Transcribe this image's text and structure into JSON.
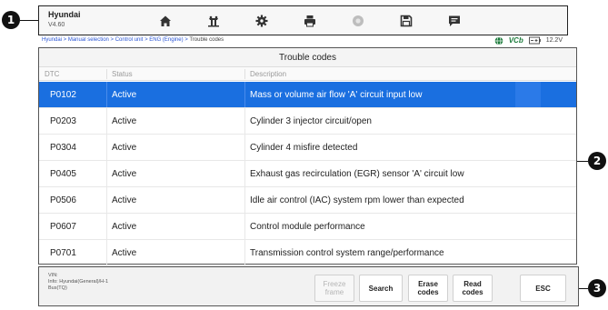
{
  "callouts": [
    "1",
    "2",
    "3"
  ],
  "app": {
    "title": "Hyundai",
    "version": "V4.60"
  },
  "toolbar": {
    "buttons": [
      {
        "icon": "home-icon"
      },
      {
        "icon": "vehicle-lift-icon"
      },
      {
        "icon": "settings-gear-icon"
      },
      {
        "icon": "print-icon"
      },
      {
        "icon": "help-icon"
      },
      {
        "icon": "save-icon"
      },
      {
        "icon": "data-logging-icon"
      }
    ]
  },
  "breadcrumb": {
    "path": "Hyundai > Manual selection > Control unit > ENG (Engine) > ",
    "current": "Trouble codes"
  },
  "status": {
    "vci": "VCb",
    "battery": "12.2V"
  },
  "trouble_codes": {
    "title": "Trouble codes",
    "columns": {
      "dtc": "DTC",
      "status": "Status",
      "description": "Description"
    },
    "rows": [
      {
        "dtc": "P0102",
        "status": "Active",
        "description": "Mass or volume air flow 'A' circuit input low"
      },
      {
        "dtc": "P0203",
        "status": "Active",
        "description": "Cylinder 3 injector circuit/open"
      },
      {
        "dtc": "P0304",
        "status": "Active",
        "description": "Cylinder 4 misfire detected"
      },
      {
        "dtc": "P0405",
        "status": "Active",
        "description": "Exhaust gas recirculation (EGR) sensor 'A' circuit low"
      },
      {
        "dtc": "P0506",
        "status": "Active",
        "description": "Idle air control (IAC) system rpm lower than expected"
      },
      {
        "dtc": "P0607",
        "status": "Active",
        "description": "Control module performance"
      },
      {
        "dtc": "P0701",
        "status": "Active",
        "description": "Transmission control system range/performance"
      }
    ]
  },
  "vehicle_info": {
    "vin": "VIN:",
    "info": "Info: Hyundai(General)/H-1",
    "bus": "Bus(TQ)"
  },
  "buttons": {
    "freeze_frame": "Freeze\nframe",
    "search": "Search",
    "erase_codes": "Erase\ncodes",
    "read_codes": "Read\ncodes",
    "esc": "ESC"
  },
  "colors": {
    "selection": "#1a6fe0",
    "breadcrumb_link": "#2a55d4",
    "vci": "#1a7a3a"
  }
}
